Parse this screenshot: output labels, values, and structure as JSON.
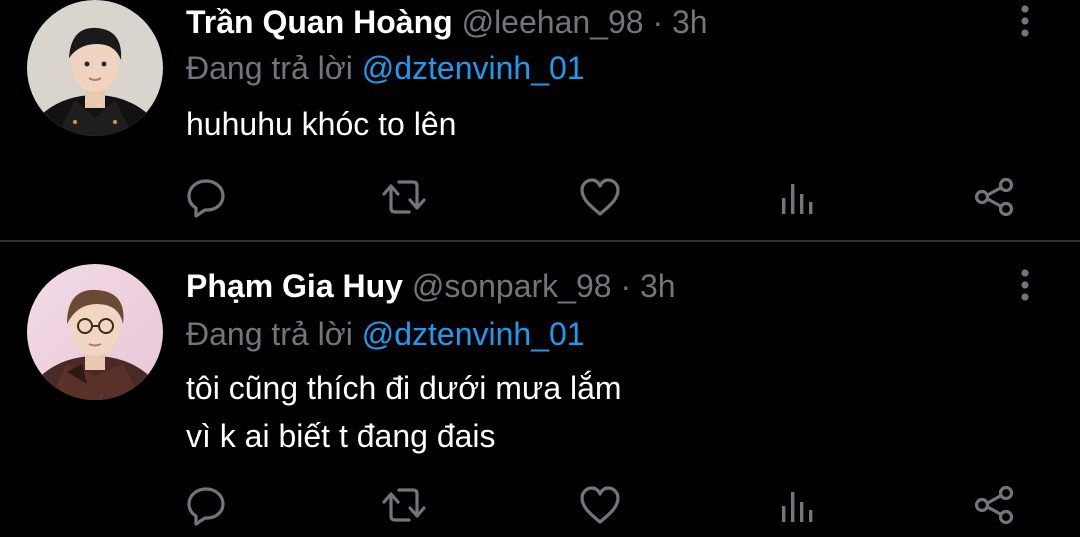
{
  "theme": {
    "background": "#000000",
    "divider": "#2f3336",
    "muted": "#71767b",
    "link": "#1d9bf0",
    "text": "#ffffff"
  },
  "tweets": [
    {
      "display_name": "Trần Quan Hoàng",
      "handle": "@leehan_98",
      "separator": "·",
      "time": "3h",
      "replying_prefix": "Đang trả lời",
      "replying_to": "@dztenvinh_01",
      "text_lines": [
        "huhuhu khóc to lên"
      ],
      "avatar_icon": "avatar-photo",
      "actions": [
        "reply-icon",
        "retweet-icon",
        "like-icon",
        "stats-icon",
        "share-icon"
      ],
      "more_icon": "more-vertical-icon"
    },
    {
      "display_name": "Phạm Gia Huy",
      "handle": "@sonpark_98",
      "separator": "·",
      "time": "3h",
      "replying_prefix": "Đang trả lời",
      "replying_to": "@dztenvinh_01",
      "text_lines": [
        "tôi cũng thích đi dưới mưa lắm",
        "vì k ai biết t đang đais"
      ],
      "avatar_icon": "avatar-photo",
      "actions": [
        "reply-icon",
        "retweet-icon",
        "like-icon",
        "stats-icon",
        "share-icon"
      ],
      "more_icon": "more-vertical-icon"
    }
  ]
}
